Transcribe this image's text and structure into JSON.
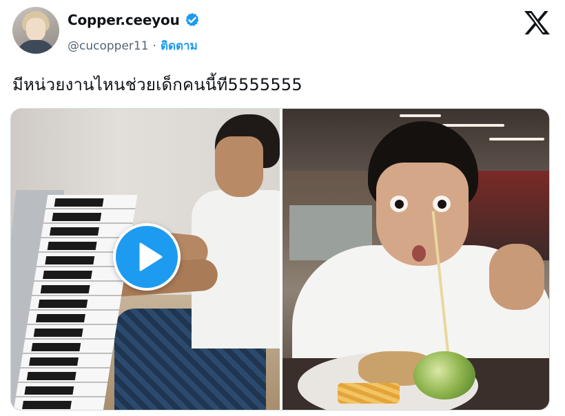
{
  "header": {
    "display_name": "Copper.ceeyou",
    "handle": "@cucopper11",
    "separator": "·",
    "follow_label": "ติดตาม",
    "verified_icon": "verified-badge-icon",
    "logo_icon": "x-logo-icon"
  },
  "post": {
    "text": "มีหน่วยงานไหนช่วยเด็กคนนี้ที5555555"
  },
  "media": {
    "items": [
      {
        "type": "video",
        "icon": "play-icon"
      },
      {
        "type": "photo"
      }
    ]
  },
  "colors": {
    "accent": "#1d9bf0",
    "text": "#0f1419",
    "secondary_text": "#536471",
    "border": "#cfd9de"
  }
}
